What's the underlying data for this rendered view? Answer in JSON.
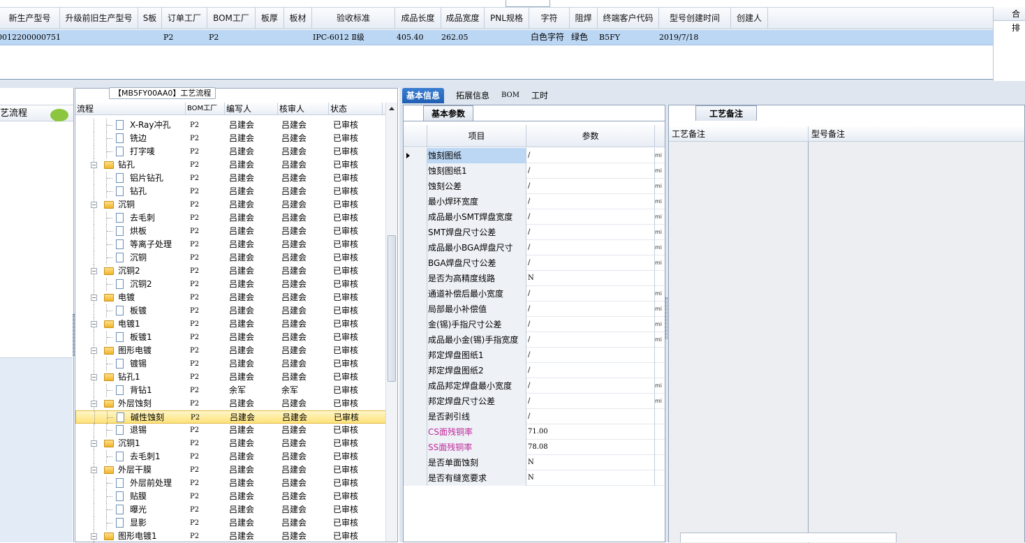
{
  "top_header": {
    "columns": [
      "新生产型号",
      "升级前旧生产型号",
      "S板",
      "订单工厂",
      "BOM工厂",
      "板厚",
      "板材",
      "验收标准",
      "成品长度",
      "成品宽度",
      "PNL规格",
      "字符",
      "阻焊",
      "终端客户代码",
      "型号创建时间",
      "创建人"
    ],
    "row": {
      "new_model": "0012200000751",
      "old_model": "",
      "s_board": "",
      "order_factory": "P2",
      "bom_factory": "P2",
      "thickness": "",
      "material": "",
      "standard": "IPC-6012 Ⅱ级",
      "length": "405.40",
      "width": "262.05",
      "pnl": "",
      "legend": "白色字符",
      "mask": "绿色",
      "customer_code": "B5FY",
      "created": "2019/7/18",
      "creator": ""
    },
    "right_strip_label": "合排"
  },
  "left_panel": {
    "title": "艺流程"
  },
  "tree_panel": {
    "title": "【MB5FY00AA0】工艺流程",
    "headers": [
      "流程",
      "BOM工厂",
      "编写人",
      "核审人",
      "状态"
    ],
    "rows": [
      {
        "name": "X-Ray冲孔",
        "bom": "P2",
        "writer": "吕建会",
        "reviewer": "吕建会",
        "status": "已审核"
      },
      {
        "name": "铣边",
        "bom": "P2",
        "writer": "吕建会",
        "reviewer": "吕建会",
        "status": "已审核"
      },
      {
        "name": "打字唛",
        "bom": "P2",
        "writer": "吕建会",
        "reviewer": "吕建会",
        "status": "已审核"
      },
      {
        "name": "钻孔",
        "bom": "P2",
        "writer": "吕建会",
        "reviewer": "吕建会",
        "status": "已审核"
      },
      {
        "name": "铝片钻孔",
        "bom": "P2",
        "writer": "吕建会",
        "reviewer": "吕建会",
        "status": "已审核"
      },
      {
        "name": "钻孔",
        "bom": "P2",
        "writer": "吕建会",
        "reviewer": "吕建会",
        "status": "已审核"
      },
      {
        "name": "沉铜",
        "bom": "P2",
        "writer": "吕建会",
        "reviewer": "吕建会",
        "status": "已审核"
      },
      {
        "name": "去毛刺",
        "bom": "P2",
        "writer": "吕建会",
        "reviewer": "吕建会",
        "status": "已审核"
      },
      {
        "name": "烘板",
        "bom": "P2",
        "writer": "吕建会",
        "reviewer": "吕建会",
        "status": "已审核"
      },
      {
        "name": "等离子处理",
        "bom": "P2",
        "writer": "吕建会",
        "reviewer": "吕建会",
        "status": "已审核"
      },
      {
        "name": "沉铜",
        "bom": "P2",
        "writer": "吕建会",
        "reviewer": "吕建会",
        "status": "已审核"
      },
      {
        "name": "沉铜2",
        "bom": "P2",
        "writer": "吕建会",
        "reviewer": "吕建会",
        "status": "已审核"
      },
      {
        "name": "沉铜2",
        "bom": "P2",
        "writer": "吕建会",
        "reviewer": "吕建会",
        "status": "已审核"
      },
      {
        "name": "电镀",
        "bom": "P2",
        "writer": "吕建会",
        "reviewer": "吕建会",
        "status": "已审核"
      },
      {
        "name": "板镀",
        "bom": "P2",
        "writer": "吕建会",
        "reviewer": "吕建会",
        "status": "已审核"
      },
      {
        "name": "电镀1",
        "bom": "P2",
        "writer": "吕建会",
        "reviewer": "吕建会",
        "status": "已审核"
      },
      {
        "name": "板镀1",
        "bom": "P2",
        "writer": "吕建会",
        "reviewer": "吕建会",
        "status": "已审核"
      },
      {
        "name": "图形电镀",
        "bom": "P2",
        "writer": "吕建会",
        "reviewer": "吕建会",
        "status": "已审核"
      },
      {
        "name": "镀锡",
        "bom": "P2",
        "writer": "吕建会",
        "reviewer": "吕建会",
        "status": "已审核"
      },
      {
        "name": "钻孔1",
        "bom": "P2",
        "writer": "吕建会",
        "reviewer": "吕建会",
        "status": "已审核"
      },
      {
        "name": "背钻1",
        "bom": "P2",
        "writer": "余军",
        "reviewer": "余军",
        "status": "已审核"
      },
      {
        "name": "外层蚀刻",
        "bom": "P2",
        "writer": "吕建会",
        "reviewer": "吕建会",
        "status": "已审核"
      },
      {
        "name": "碱性蚀刻",
        "bom": "P2",
        "writer": "吕建会",
        "reviewer": "吕建会",
        "status": "已审核"
      },
      {
        "name": "退锡",
        "bom": "P2",
        "writer": "吕建会",
        "reviewer": "吕建会",
        "status": "已审核"
      },
      {
        "name": "沉铜1",
        "bom": "P2",
        "writer": "吕建会",
        "reviewer": "吕建会",
        "status": "已审核"
      },
      {
        "name": "去毛刺1",
        "bom": "P2",
        "writer": "吕建会",
        "reviewer": "吕建会",
        "status": "已审核"
      },
      {
        "name": "外层干膜",
        "bom": "P2",
        "writer": "吕建会",
        "reviewer": "吕建会",
        "status": "已审核"
      },
      {
        "name": "外层前处理",
        "bom": "P2",
        "writer": "吕建会",
        "reviewer": "吕建会",
        "status": "已审核"
      },
      {
        "name": "贴膜",
        "bom": "P2",
        "writer": "吕建会",
        "reviewer": "吕建会",
        "status": "已审核"
      },
      {
        "name": "曝光",
        "bom": "P2",
        "writer": "吕建会",
        "reviewer": "吕建会",
        "status": "已审核"
      },
      {
        "name": "显影",
        "bom": "P2",
        "writer": "吕建会",
        "reviewer": "吕建会",
        "status": "已审核"
      },
      {
        "name": "图形电镀1",
        "bom": "P2",
        "writer": "吕建会",
        "reviewer": "吕建会",
        "status": "已审核"
      }
    ]
  },
  "right_tabs": [
    "基本信息",
    "拓展信息",
    "BOM",
    "工时"
  ],
  "basic_params": {
    "tab": "基本参数",
    "headers": [
      "项目",
      "参数"
    ],
    "rows": [
      {
        "item": "蚀刻图纸",
        "value": "/",
        "unit": "mi",
        "pink": false
      },
      {
        "item": "蚀刻图纸1",
        "value": "/",
        "unit": "mi",
        "pink": false
      },
      {
        "item": "蚀刻公差",
        "value": "/",
        "unit": "mi",
        "pink": false
      },
      {
        "item": "最小焊环宽度",
        "value": "/",
        "unit": "mi",
        "pink": false
      },
      {
        "item": "成品最小SMT焊盘宽度",
        "value": "/",
        "unit": "mi",
        "pink": false
      },
      {
        "item": "SMT焊盘尺寸公差",
        "value": "/",
        "unit": "mi",
        "pink": false
      },
      {
        "item": "成品最小BGA焊盘尺寸",
        "value": "/",
        "unit": "mi",
        "pink": false
      },
      {
        "item": "BGA焊盘尺寸公差",
        "value": "/",
        "unit": "mi",
        "pink": false
      },
      {
        "item": "是否为高精度线路",
        "value": "N",
        "unit": "",
        "pink": false
      },
      {
        "item": "通道补偿后最小宽度",
        "value": "/",
        "unit": "mi",
        "pink": false
      },
      {
        "item": "局部最小补偿值",
        "value": "/",
        "unit": "mi",
        "pink": false
      },
      {
        "item": "金(锡)手指尺寸公差",
        "value": "/",
        "unit": "mi",
        "pink": false
      },
      {
        "item": "成品最小金(锡)手指宽度",
        "value": "/",
        "unit": "mi",
        "pink": false
      },
      {
        "item": "邦定焊盘图纸1",
        "value": "/",
        "unit": "",
        "pink": false
      },
      {
        "item": "邦定焊盘图纸2",
        "value": "/",
        "unit": "",
        "pink": false
      },
      {
        "item": "成品邦定焊盘最小宽度",
        "value": "/",
        "unit": "mi",
        "pink": false
      },
      {
        "item": "邦定焊盘尺寸公差",
        "value": "/",
        "unit": "mi",
        "pink": false
      },
      {
        "item": "是否剥引线",
        "value": "/",
        "unit": "",
        "pink": false
      },
      {
        "item": "CS面残铜率",
        "value": "71.00",
        "unit": "",
        "pink": true
      },
      {
        "item": "SS面残铜率",
        "value": "78.08",
        "unit": "",
        "pink": true
      },
      {
        "item": "是否单面蚀刻",
        "value": "N",
        "unit": "",
        "pink": false
      },
      {
        "item": "是否有缝宽要求",
        "value": "N",
        "unit": "",
        "pink": false
      }
    ]
  },
  "notes": {
    "tab": "工艺备注",
    "col1": "工艺备注",
    "col2": "型号备注"
  }
}
